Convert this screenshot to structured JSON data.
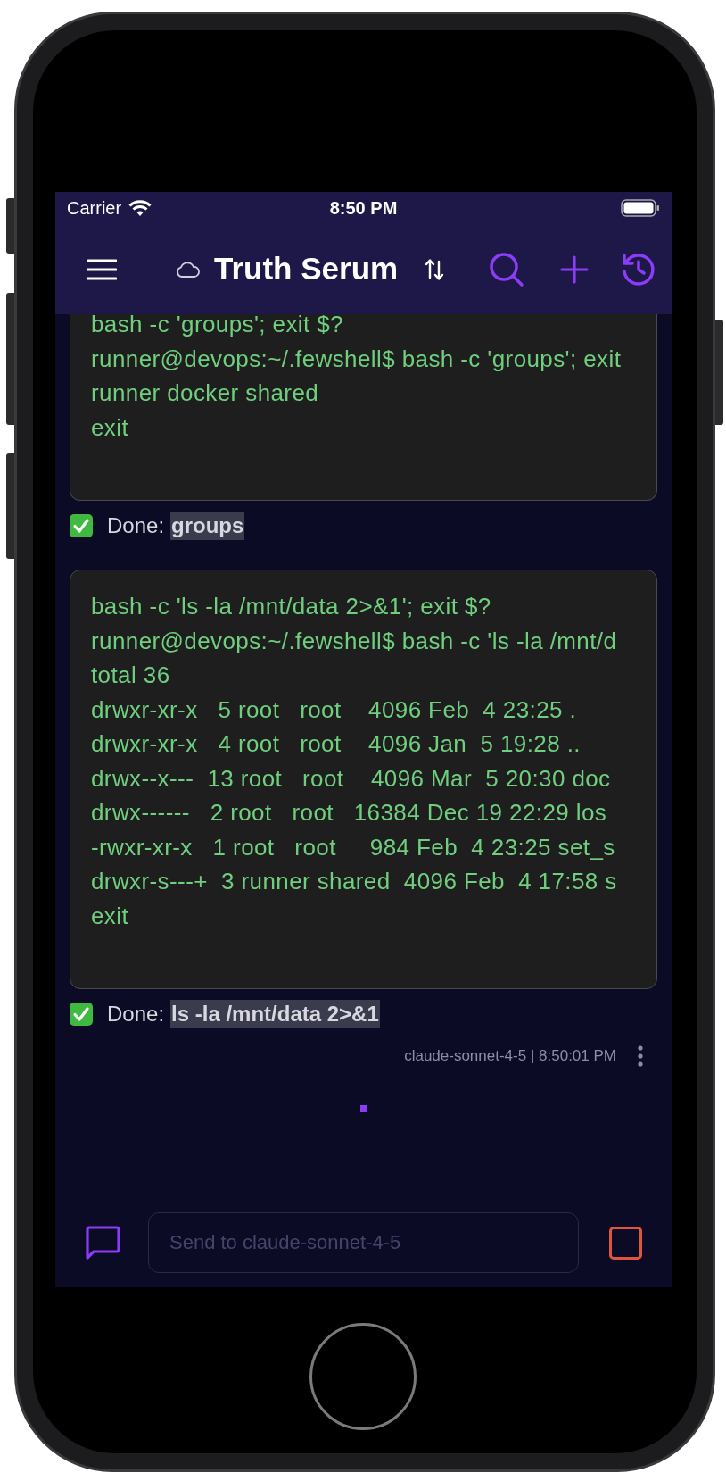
{
  "status_bar": {
    "carrier": "Carrier",
    "time": "8:50 PM"
  },
  "nav_bar": {
    "title": "Truth Serum"
  },
  "messages": [
    {
      "kind": "terminal",
      "lines": [
        "bash -c 'groups'; exit $?",
        "runner@devops:~/.fewshell$ bash -c 'groups'; exit",
        "runner docker shared",
        "exit"
      ],
      "status": "Done:",
      "command": "groups"
    },
    {
      "kind": "terminal",
      "lines": [
        "bash -c 'ls -la /mnt/data 2>&1'; exit $?",
        "runner@devops:~/.fewshell$ bash -c 'ls -la /mnt/d",
        "total 36",
        "drwxr-xr-x   5 root   root    4096 Feb  4 23:25 .",
        "drwxr-xr-x   4 root   root    4096 Jan  5 19:28 ..",
        "drwx--x---  13 root   root    4096 Mar  5 20:30 doc",
        "drwx------   2 root   root   16384 Dec 19 22:29 los",
        "-rwxr-xr-x   1 root   root     984 Feb  4 23:25 set_s",
        "drwxr-s---+  3 runner shared  4096 Feb  4 17:58 s",
        "exit"
      ],
      "status": "Done:",
      "command": "ls -la /mnt/data 2>&1"
    }
  ],
  "meta": {
    "text": "claude-sonnet-4-5 | 8:50:01 PM"
  },
  "composer": {
    "placeholder": "Send to claude-sonnet-4-5"
  }
}
